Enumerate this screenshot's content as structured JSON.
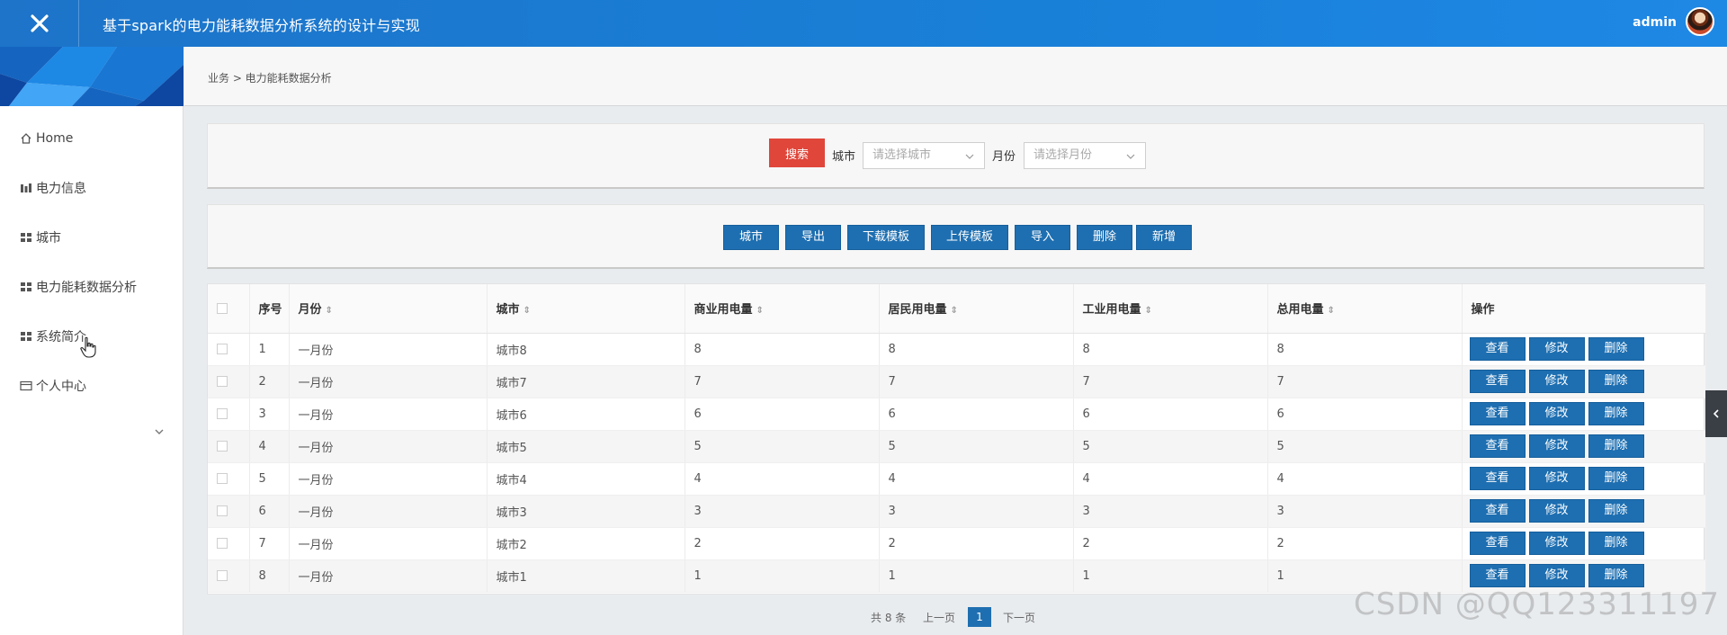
{
  "header": {
    "title": "基于spark的电力能耗数据分析系统的设计与实现",
    "user": "admin"
  },
  "sidebar": {
    "items": [
      {
        "label": "Home",
        "icon": "home-icon"
      },
      {
        "label": "电力信息",
        "icon": "bar-chart-icon"
      },
      {
        "label": "城市",
        "icon": "grid-icon"
      },
      {
        "label": "电力能耗数据分析",
        "icon": "grid-icon"
      },
      {
        "label": "系统简介",
        "icon": "grid-icon"
      },
      {
        "label": "个人中心",
        "icon": "card-icon"
      }
    ]
  },
  "breadcrumb": {
    "text": "业务 > 电力能耗数据分析"
  },
  "search": {
    "button": "搜索",
    "city_label": "城市",
    "city_placeholder": "请选择城市",
    "month_label": "月份",
    "month_placeholder": "请选择月份"
  },
  "toolbar": {
    "city": "城市",
    "export": "导出",
    "download_template": "下载模板",
    "upload_template": "上传模板",
    "import": "导入",
    "delete": "删除",
    "add": "新增"
  },
  "table": {
    "headers": {
      "index": "序号",
      "month": "月份",
      "city": "城市",
      "commercial": "商业用电量",
      "residential": "居民用电量",
      "industrial": "工业用电量",
      "total": "总用电量",
      "actions": "操作"
    },
    "actions": {
      "view": "查看",
      "edit": "修改",
      "delete": "删除"
    },
    "rows": [
      {
        "index": "1",
        "month": "一月份",
        "city": "城市8",
        "commercial": "8",
        "residential": "8",
        "industrial": "8",
        "total": "8"
      },
      {
        "index": "2",
        "month": "一月份",
        "city": "城市7",
        "commercial": "7",
        "residential": "7",
        "industrial": "7",
        "total": "7"
      },
      {
        "index": "3",
        "month": "一月份",
        "city": "城市6",
        "commercial": "6",
        "residential": "6",
        "industrial": "6",
        "total": "6"
      },
      {
        "index": "4",
        "month": "一月份",
        "city": "城市5",
        "commercial": "5",
        "residential": "5",
        "industrial": "5",
        "total": "5"
      },
      {
        "index": "5",
        "month": "一月份",
        "city": "城市4",
        "commercial": "4",
        "residential": "4",
        "industrial": "4",
        "total": "4"
      },
      {
        "index": "6",
        "month": "一月份",
        "city": "城市3",
        "commercial": "3",
        "residential": "3",
        "industrial": "3",
        "total": "3"
      },
      {
        "index": "7",
        "month": "一月份",
        "city": "城市2",
        "commercial": "2",
        "residential": "2",
        "industrial": "2",
        "total": "2"
      },
      {
        "index": "8",
        "month": "一月份",
        "city": "城市1",
        "commercial": "1",
        "residential": "1",
        "industrial": "1",
        "total": "1"
      }
    ]
  },
  "pagination": {
    "total": "共 8 条",
    "prev": "上一页",
    "current": "1",
    "next": "下一页"
  },
  "watermark": "CSDN @QQ123311197"
}
